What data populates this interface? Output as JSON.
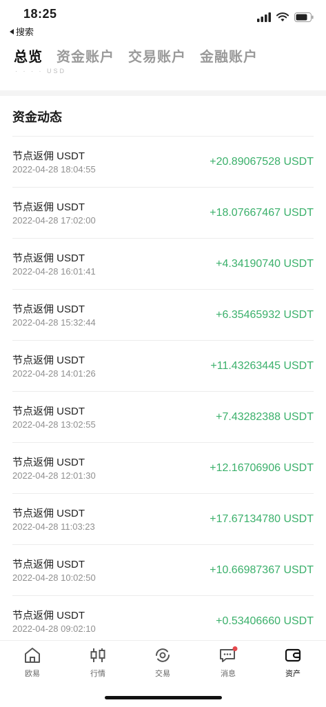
{
  "status_bar": {
    "time": "18:25",
    "back_label": "搜索"
  },
  "tabs": [
    {
      "label": "总览",
      "active": true
    },
    {
      "label": "资金账户",
      "active": false
    },
    {
      "label": "交易账户",
      "active": false
    },
    {
      "label": "金融账户",
      "active": false
    }
  ],
  "peek_text": "· · · ·  USD",
  "section": {
    "title": "资金动态"
  },
  "transactions": [
    {
      "title": "节点返佣 USDT",
      "date": "2022-04-28 18:04:55",
      "amount": "+20.89067528 USDT"
    },
    {
      "title": "节点返佣 USDT",
      "date": "2022-04-28 17:02:00",
      "amount": "+18.07667467 USDT"
    },
    {
      "title": "节点返佣 USDT",
      "date": "2022-04-28 16:01:41",
      "amount": "+4.34190740 USDT"
    },
    {
      "title": "节点返佣 USDT",
      "date": "2022-04-28 15:32:44",
      "amount": "+6.35465932 USDT"
    },
    {
      "title": "节点返佣 USDT",
      "date": "2022-04-28 14:01:26",
      "amount": "+11.43263445 USDT"
    },
    {
      "title": "节点返佣 USDT",
      "date": "2022-04-28 13:02:55",
      "amount": "+7.43282388 USDT"
    },
    {
      "title": "节点返佣 USDT",
      "date": "2022-04-28 12:01:30",
      "amount": "+12.16706906 USDT"
    },
    {
      "title": "节点返佣 USDT",
      "date": "2022-04-28 11:03:23",
      "amount": "+17.67134780 USDT"
    },
    {
      "title": "节点返佣 USDT",
      "date": "2022-04-28 10:02:50",
      "amount": "+10.66987367 USDT"
    },
    {
      "title": "节点返佣 USDT",
      "date": "2022-04-28 09:02:10",
      "amount": "+0.53406660 USDT"
    }
  ],
  "nav": [
    {
      "label": "欧易",
      "icon": "home-icon",
      "active": false
    },
    {
      "label": "行情",
      "icon": "candlestick-icon",
      "active": false
    },
    {
      "label": "交易",
      "icon": "trade-icon",
      "active": false
    },
    {
      "label": "消息",
      "icon": "message-icon",
      "active": false,
      "badge": true
    },
    {
      "label": "资产",
      "icon": "wallet-icon",
      "active": true
    }
  ],
  "colors": {
    "positive": "#3bb06b",
    "badge": "#e5484d",
    "muted": "#9a9a9a"
  }
}
